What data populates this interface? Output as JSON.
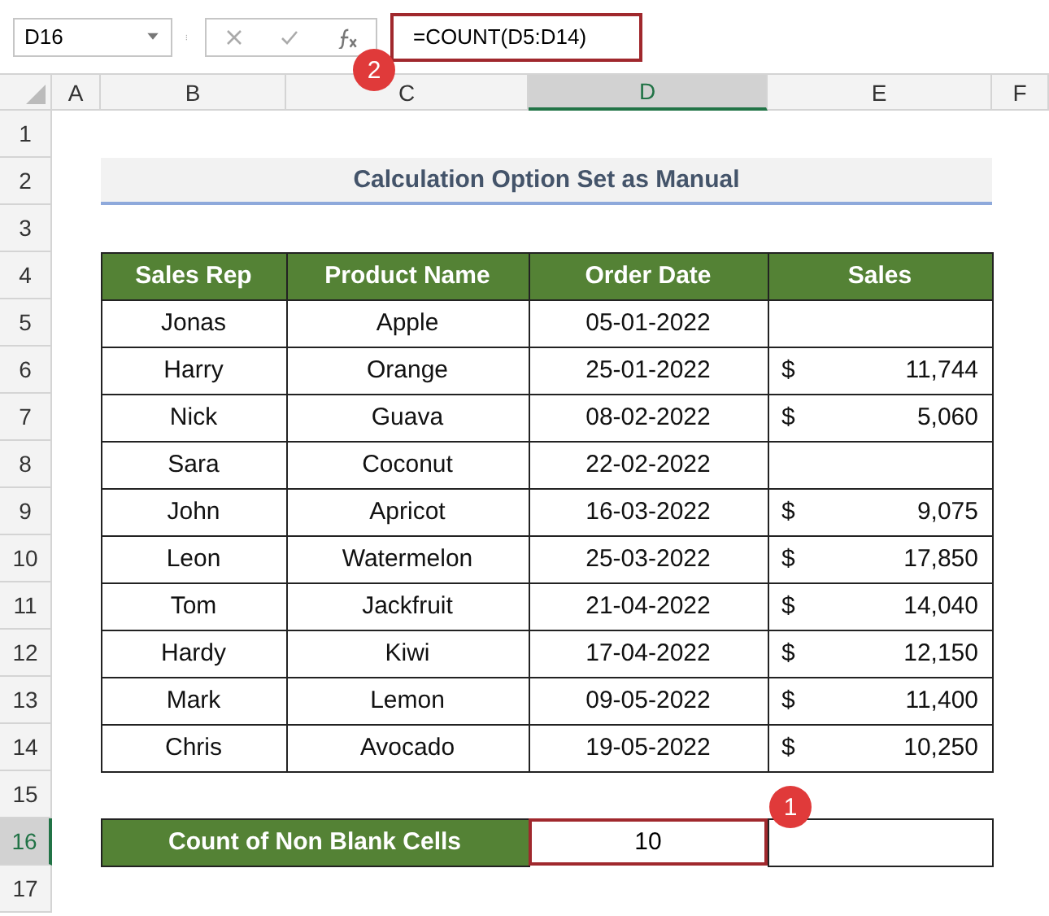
{
  "formula_bar": {
    "name_box": "D16",
    "formula": "=COUNT(D5:D14)"
  },
  "columns": [
    {
      "label": "A",
      "selected": false
    },
    {
      "label": "B",
      "selected": false
    },
    {
      "label": "C",
      "selected": false
    },
    {
      "label": "D",
      "selected": true
    },
    {
      "label": "E",
      "selected": false
    },
    {
      "label": "F",
      "selected": false
    }
  ],
  "row_numbers": [
    {
      "label": "1",
      "selected": false
    },
    {
      "label": "2",
      "selected": false
    },
    {
      "label": "3",
      "selected": false
    },
    {
      "label": "4",
      "selected": false
    },
    {
      "label": "5",
      "selected": false
    },
    {
      "label": "6",
      "selected": false
    },
    {
      "label": "7",
      "selected": false
    },
    {
      "label": "8",
      "selected": false
    },
    {
      "label": "9",
      "selected": false
    },
    {
      "label": "10",
      "selected": false
    },
    {
      "label": "11",
      "selected": false
    },
    {
      "label": "12",
      "selected": false
    },
    {
      "label": "13",
      "selected": false
    },
    {
      "label": "14",
      "selected": false
    },
    {
      "label": "15",
      "selected": false
    },
    {
      "label": "16",
      "selected": true
    },
    {
      "label": "17",
      "selected": false
    }
  ],
  "title": "Calculation Option Set as Manual",
  "table": {
    "columns": [
      "Sales Rep",
      "Product Name",
      "Order Date",
      "Sales"
    ],
    "rows": [
      {
        "rep": "Jonas",
        "product": "Apple",
        "date": "05-01-2022"
      },
      {
        "rep": "Harry",
        "product": "Orange",
        "date": "25-01-2022",
        "currency": "$",
        "amount": "11,744"
      },
      {
        "rep": "Nick",
        "product": "Guava",
        "date": "08-02-2022",
        "currency": "$",
        "amount": "5,060"
      },
      {
        "rep": "Sara",
        "product": "Coconut",
        "date": "22-02-2022"
      },
      {
        "rep": "John",
        "product": "Apricot",
        "date": "16-03-2022",
        "currency": "$",
        "amount": "9,075"
      },
      {
        "rep": "Leon",
        "product": "Watermelon",
        "date": "25-03-2022",
        "currency": "$",
        "amount": "17,850"
      },
      {
        "rep": "Tom",
        "product": "Jackfruit",
        "date": "21-04-2022",
        "currency": "$",
        "amount": "14,040"
      },
      {
        "rep": "Hardy",
        "product": "Kiwi",
        "date": "17-04-2022",
        "currency": "$",
        "amount": "12,150"
      },
      {
        "rep": "Mark",
        "product": "Lemon",
        "date": "09-05-2022",
        "currency": "$",
        "amount": "11,400"
      },
      {
        "rep": "Chris",
        "product": "Avocado",
        "date": "19-05-2022",
        "currency": "$",
        "amount": "10,250"
      }
    ]
  },
  "summary": {
    "label": "Count of Non Blank Cells",
    "value": "10"
  },
  "callouts": [
    "1",
    "2"
  ]
}
